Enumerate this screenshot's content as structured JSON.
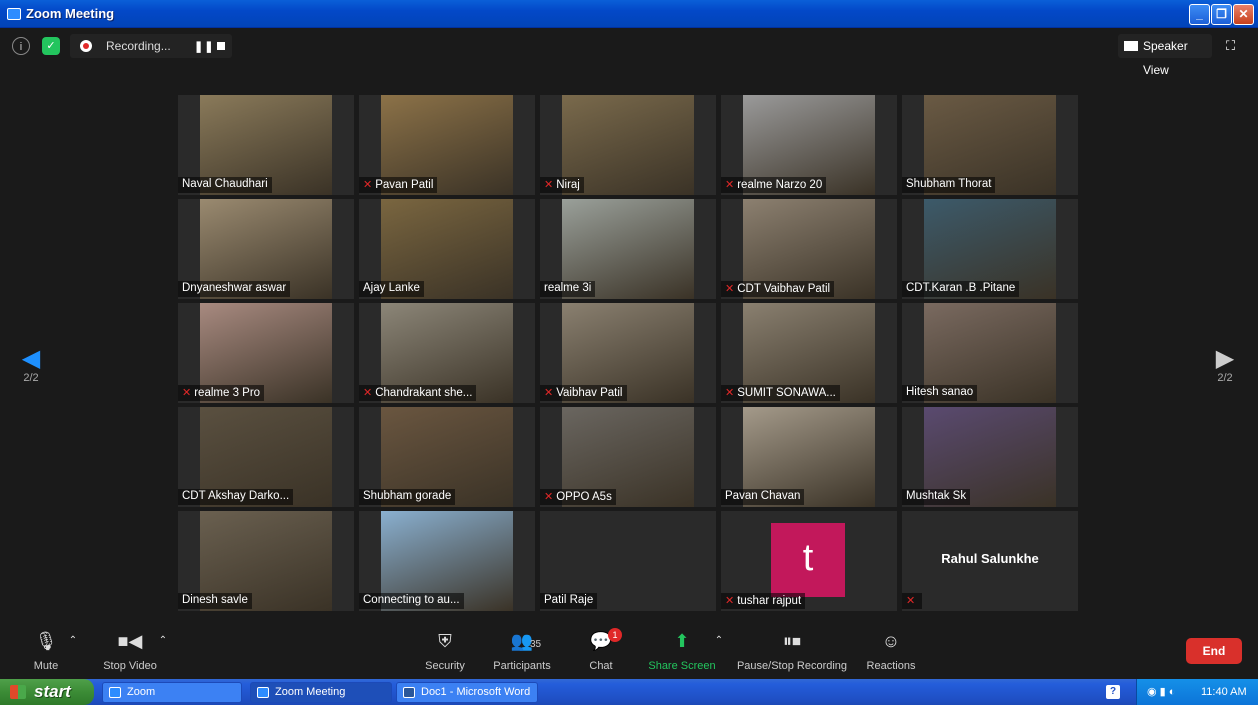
{
  "window": {
    "title": "Zoom Meeting"
  },
  "topbar": {
    "recording_label": "Recording...",
    "speaker_view_label": "Speaker View"
  },
  "nav": {
    "page_left": "2/2",
    "page_right": "2/2"
  },
  "participants": [
    {
      "name": "Naval Chaudhari",
      "muted": false,
      "color": "#8a7a5a"
    },
    {
      "name": "Pavan Patil",
      "muted": true,
      "color": "#8c7248"
    },
    {
      "name": "Niraj",
      "muted": true,
      "color": "#7a6a4c"
    },
    {
      "name": "realme Narzo 20",
      "muted": true,
      "color": "#9a9a9a"
    },
    {
      "name": "Shubham Thorat",
      "muted": false,
      "color": "#6a5a44"
    },
    {
      "name": "Dnyaneshwar aswar",
      "muted": false,
      "color": "#9a8a70"
    },
    {
      "name": "Ajay Lanke",
      "muted": false,
      "color": "#7a6640"
    },
    {
      "name": "realme 3i",
      "muted": false,
      "color": "#9aa09a"
    },
    {
      "name": "CDT Vaibhav Patil",
      "muted": true,
      "color": "#8c8070"
    },
    {
      "name": "CDT.Karan .B .Pitane",
      "muted": false,
      "color": "#3c5a6a"
    },
    {
      "name": "realme 3 Pro",
      "muted": true,
      "color": "#a88a80"
    },
    {
      "name": "Chandrakant she...",
      "muted": true,
      "color": "#8c8678"
    },
    {
      "name": "Vaibhav Patil",
      "muted": true,
      "color": "#8a8070"
    },
    {
      "name": "SUMIT SONAWA...",
      "muted": true,
      "color": "#8a8070"
    },
    {
      "name": "Hitesh sanao",
      "muted": false,
      "color": "#7a6a60"
    },
    {
      "name": "CDT Akshay  Darko...",
      "muted": false,
      "color": "#5a5040"
    },
    {
      "name": "Shubham gorade",
      "muted": false,
      "color": "#6a5640"
    },
    {
      "name": "OPPO A5s",
      "muted": true,
      "color": "#6a6660"
    },
    {
      "name": "Pavan Chavan",
      "muted": false,
      "color": "#a49a8a"
    },
    {
      "name": "Mushtak Sk",
      "muted": false,
      "color": "#5a4a70"
    },
    {
      "name": "Dinesh savle",
      "muted": false,
      "color": "#6a6050"
    },
    {
      "name": "Connecting to au...",
      "muted": false,
      "color": "#8ab0d0"
    },
    {
      "name": "Patil Raje",
      "muted": false,
      "color": "#1a1a1a"
    },
    {
      "name": "tushar rajput",
      "muted": true,
      "avatar_letter": "t",
      "color": "#c2185b"
    },
    {
      "name": "Rahul Salunkhe",
      "muted": true,
      "color": "#1a1a1a"
    }
  ],
  "toolbar": {
    "mute_label": "Mute",
    "stop_video_label": "Stop Video",
    "security_label": "Security",
    "participants_label": "Participants",
    "participants_count": "35",
    "chat_label": "Chat",
    "chat_badge": "1",
    "share_screen_label": "Share Screen",
    "pause_stop_recording_label": "Pause/Stop Recording",
    "reactions_label": "Reactions",
    "end_label": "End"
  },
  "taskbar": {
    "start_label": "start",
    "tasks": [
      "Zoom",
      "Zoom Meeting",
      "Doc1 - Microsoft Word"
    ],
    "clock": "11:40 AM"
  },
  "icons": [
    "info-icon",
    "shield-icon",
    "record-icon",
    "pause-icon",
    "stop-icon",
    "grid-icon",
    "fullscreen-icon",
    "microphone-icon",
    "camera-icon",
    "security-shield-icon",
    "participants-icon",
    "chat-icon",
    "share-screen-icon",
    "recording-control-icon",
    "reactions-icon",
    "windows-flag-icon"
  ]
}
